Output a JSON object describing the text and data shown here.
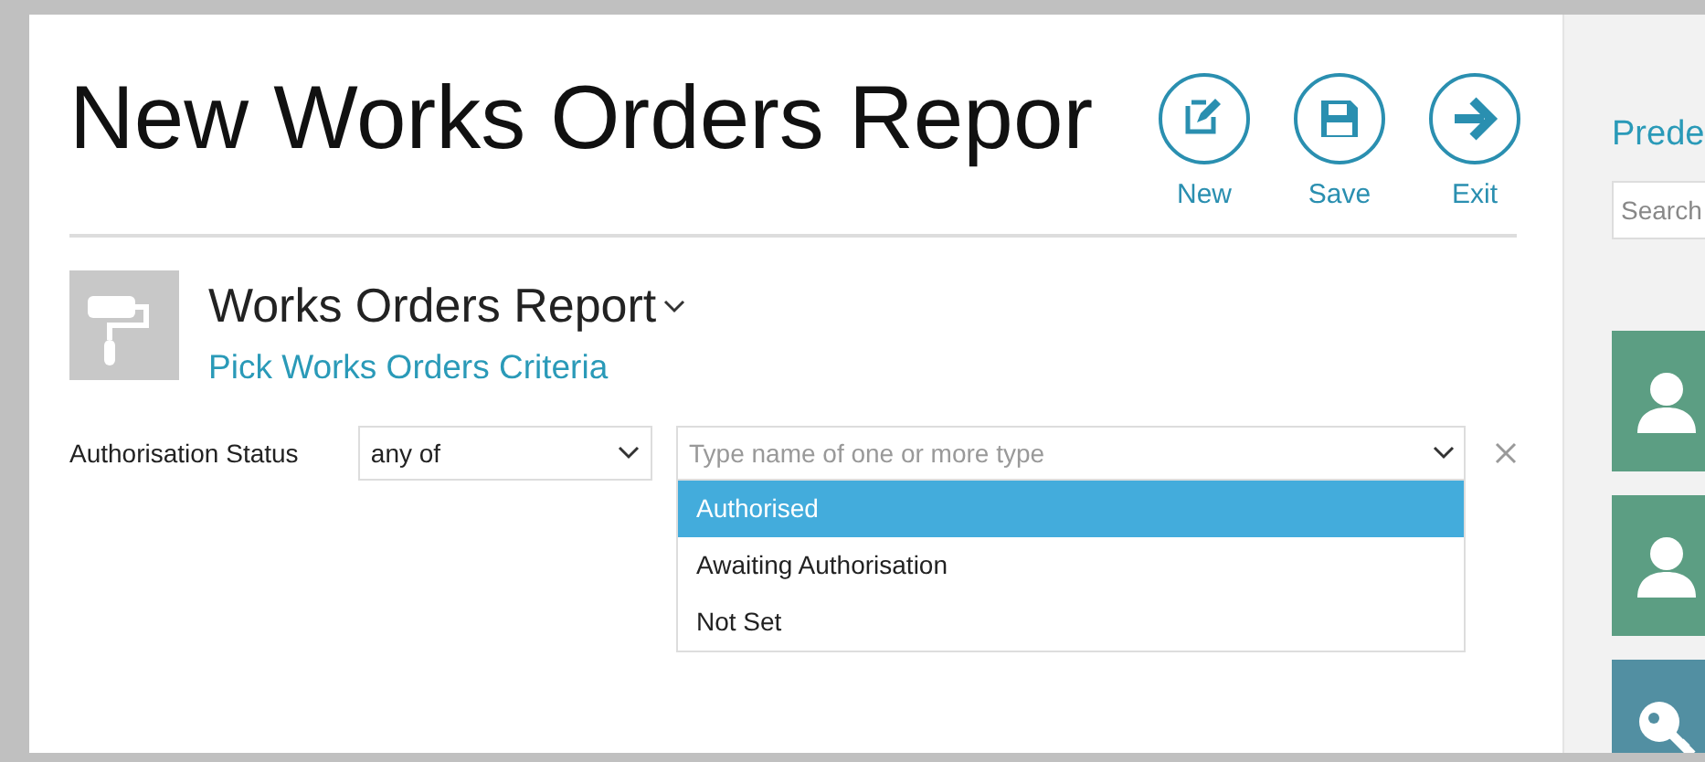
{
  "header": {
    "title": "New Works Orders Repor"
  },
  "actions": [
    {
      "label": "New",
      "kind": "new"
    },
    {
      "label": "Save",
      "kind": "save"
    },
    {
      "label": "Exit",
      "kind": "exit"
    }
  ],
  "report": {
    "title": "Works Orders Report",
    "subtitle": "Pick Works Orders Criteria"
  },
  "filter": {
    "label": "Authorisation Status",
    "operator": "any of",
    "placeholder": "Type name of one or more type",
    "options": [
      {
        "label": "Authorised",
        "selected": true
      },
      {
        "label": "Awaiting Authorisation",
        "selected": false
      },
      {
        "label": "Not Set",
        "selected": false
      }
    ]
  },
  "side_panel": {
    "title": "Prede",
    "search_placeholder": "Search",
    "tiles": [
      {
        "kind": "person",
        "color": "#5c9e83"
      },
      {
        "kind": "person",
        "color": "#5c9e83"
      },
      {
        "kind": "key",
        "color": "#528fa2"
      }
    ]
  }
}
